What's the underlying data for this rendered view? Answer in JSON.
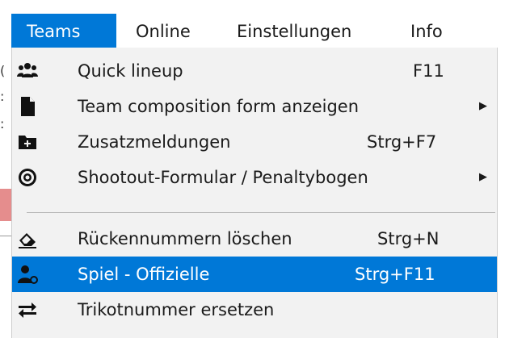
{
  "menubar": {
    "items": [
      {
        "label": "Teams",
        "active": true
      },
      {
        "label": "Online",
        "active": false
      },
      {
        "label": "Einstellungen",
        "active": false
      },
      {
        "label": "Info",
        "active": false
      }
    ]
  },
  "dropdown": {
    "items": [
      {
        "icon": "users-icon",
        "label": "Quick lineup",
        "shortcut": "F11",
        "submenu": false
      },
      {
        "icon": "file-icon",
        "label": "Team composition form anzeigen",
        "shortcut": "",
        "submenu": true
      },
      {
        "icon": "folder-plus-icon",
        "label": "Zusatzmeldungen",
        "shortcut": "Strg+F7",
        "submenu": false
      },
      {
        "icon": "target-icon",
        "label": "Shootout-Formular / Penaltybogen",
        "shortcut": "",
        "submenu": true
      },
      {
        "icon": "eraser-icon",
        "label": "Rückennummern löschen",
        "shortcut": "Strg+N",
        "submenu": false
      },
      {
        "icon": "user-official-icon",
        "label": "Spiel - Offizielle",
        "shortcut": "Strg+F11",
        "submenu": false,
        "highlighted": true
      },
      {
        "icon": "swap-arrows-icon",
        "label": "Trikotnummer ersetzen",
        "shortcut": "",
        "submenu": false
      }
    ],
    "submenu_arrow": "▶"
  },
  "colors": {
    "highlight": "#0078d7",
    "menu_background": "#f2f2f2"
  }
}
